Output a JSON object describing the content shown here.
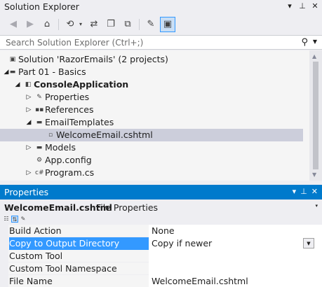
{
  "solution_explorer": {
    "title": "Solution Explorer",
    "title_icons": [
      "pin-dropdown",
      "pin",
      "close"
    ],
    "toolbar": {
      "buttons": [
        {
          "name": "back",
          "glyph": "◀",
          "disabled": true
        },
        {
          "name": "forward",
          "glyph": "▶",
          "disabled": true
        },
        {
          "name": "home",
          "glyph": "⌂",
          "disabled": false
        },
        {
          "name": "pending-changes-filter",
          "glyph": "⟲",
          "disabled": false
        },
        {
          "name": "sync-with-active-document",
          "glyph": "⇄",
          "disabled": false
        },
        {
          "name": "collapse-all",
          "glyph": "❐",
          "disabled": false
        },
        {
          "name": "show-all-files",
          "glyph": "⧉",
          "disabled": false
        },
        {
          "name": "properties",
          "glyph": "🔧",
          "disabled": false
        },
        {
          "name": "preview-selected-items",
          "glyph": "▣",
          "disabled": false,
          "active": true
        }
      ]
    },
    "search": {
      "placeholder": "Search Solution Explorer (Ctrl+;)"
    },
    "tree": [
      {
        "label": "Solution 'RazorEmails' (2 projects)",
        "level": 0,
        "arrow": "",
        "icon": "solution-icon",
        "bold": false
      },
      {
        "label": "Part 01 - Basics",
        "level": 0,
        "arrow": "expanded",
        "icon": "folder-icon",
        "bold": false
      },
      {
        "label": "ConsoleApplication",
        "level": 1,
        "arrow": "expanded",
        "icon": "csharp-project-icon",
        "bold": true
      },
      {
        "label": "Properties",
        "level": 2,
        "arrow": "collapsed",
        "icon": "wrench-icon",
        "bold": false
      },
      {
        "label": "References",
        "level": 2,
        "arrow": "collapsed",
        "icon": "references-icon",
        "bold": false
      },
      {
        "label": "EmailTemplates",
        "level": 2,
        "arrow": "expanded",
        "icon": "folder-icon",
        "bold": false
      },
      {
        "label": "WelcomeEmail.cshtml",
        "level": 3,
        "arrow": "",
        "icon": "file-icon",
        "bold": false,
        "selected": true
      },
      {
        "label": "Models",
        "level": 2,
        "arrow": "collapsed",
        "icon": "folder-icon",
        "bold": false
      },
      {
        "label": "App.config",
        "level": 2,
        "arrow": "",
        "icon": "config-file-icon",
        "bold": false
      },
      {
        "label": "Program.cs",
        "level": 2,
        "arrow": "collapsed",
        "icon": "csharp-file-icon",
        "bold": false
      }
    ]
  },
  "properties": {
    "title": "Properties",
    "object_name": "WelcomeEmail.cshtml",
    "object_type": "File Properties",
    "rows": [
      {
        "key": "Build Action",
        "value": "None",
        "selected": false,
        "dropdown": false
      },
      {
        "key": "Copy to Output Directory",
        "value": "Copy if newer",
        "selected": true,
        "dropdown": true
      },
      {
        "key": "Custom Tool",
        "value": "",
        "selected": false,
        "dropdown": false
      },
      {
        "key": "Custom Tool Namespace",
        "value": "",
        "selected": false,
        "dropdown": false
      },
      {
        "key": "File Name",
        "value": "WelcomeEmail.cshtml",
        "selected": false,
        "dropdown": false
      }
    ]
  },
  "colors": {
    "accent": "#007acc",
    "selection": "#3399ff",
    "tree_selection": "#cccedb",
    "background": "#eeeef2"
  }
}
